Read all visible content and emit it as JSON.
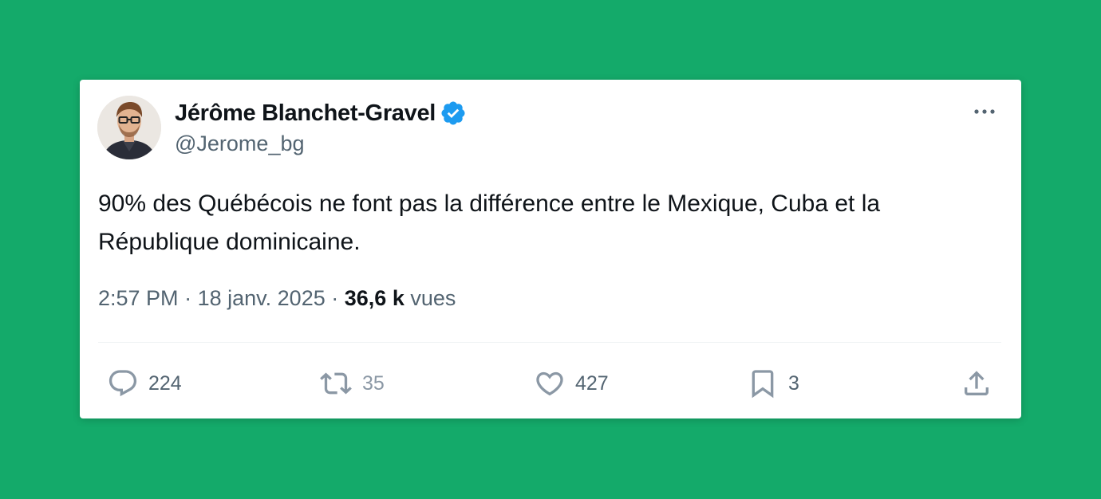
{
  "colors": {
    "background": "#14aa6a",
    "card": "#ffffff",
    "text_primary": "#0f1419",
    "text_secondary": "#536471",
    "verified_badge": "#1d9bf0"
  },
  "tweet": {
    "author": {
      "display_name": "Jérôme Blanchet-Gravel",
      "handle": "@Jerome_bg",
      "verified": true,
      "avatar_icon": "profile-photo"
    },
    "text": "90% des Québécois ne font pas la différence entre le Mexique, Cuba et la République dominicaine.",
    "time": "2:57 PM",
    "date": "18 janv. 2025",
    "separator": "·",
    "views_count": "36,6 k",
    "views_label": "vues",
    "more_icon": "more-horizontal-icon",
    "actions": {
      "reply": {
        "icon": "reply-icon",
        "count": "224"
      },
      "retweet": {
        "icon": "retweet-icon",
        "count": "35"
      },
      "like": {
        "icon": "heart-icon",
        "count": "427"
      },
      "bookmark": {
        "icon": "bookmark-icon",
        "count": "3"
      },
      "share": {
        "icon": "share-icon"
      }
    }
  }
}
